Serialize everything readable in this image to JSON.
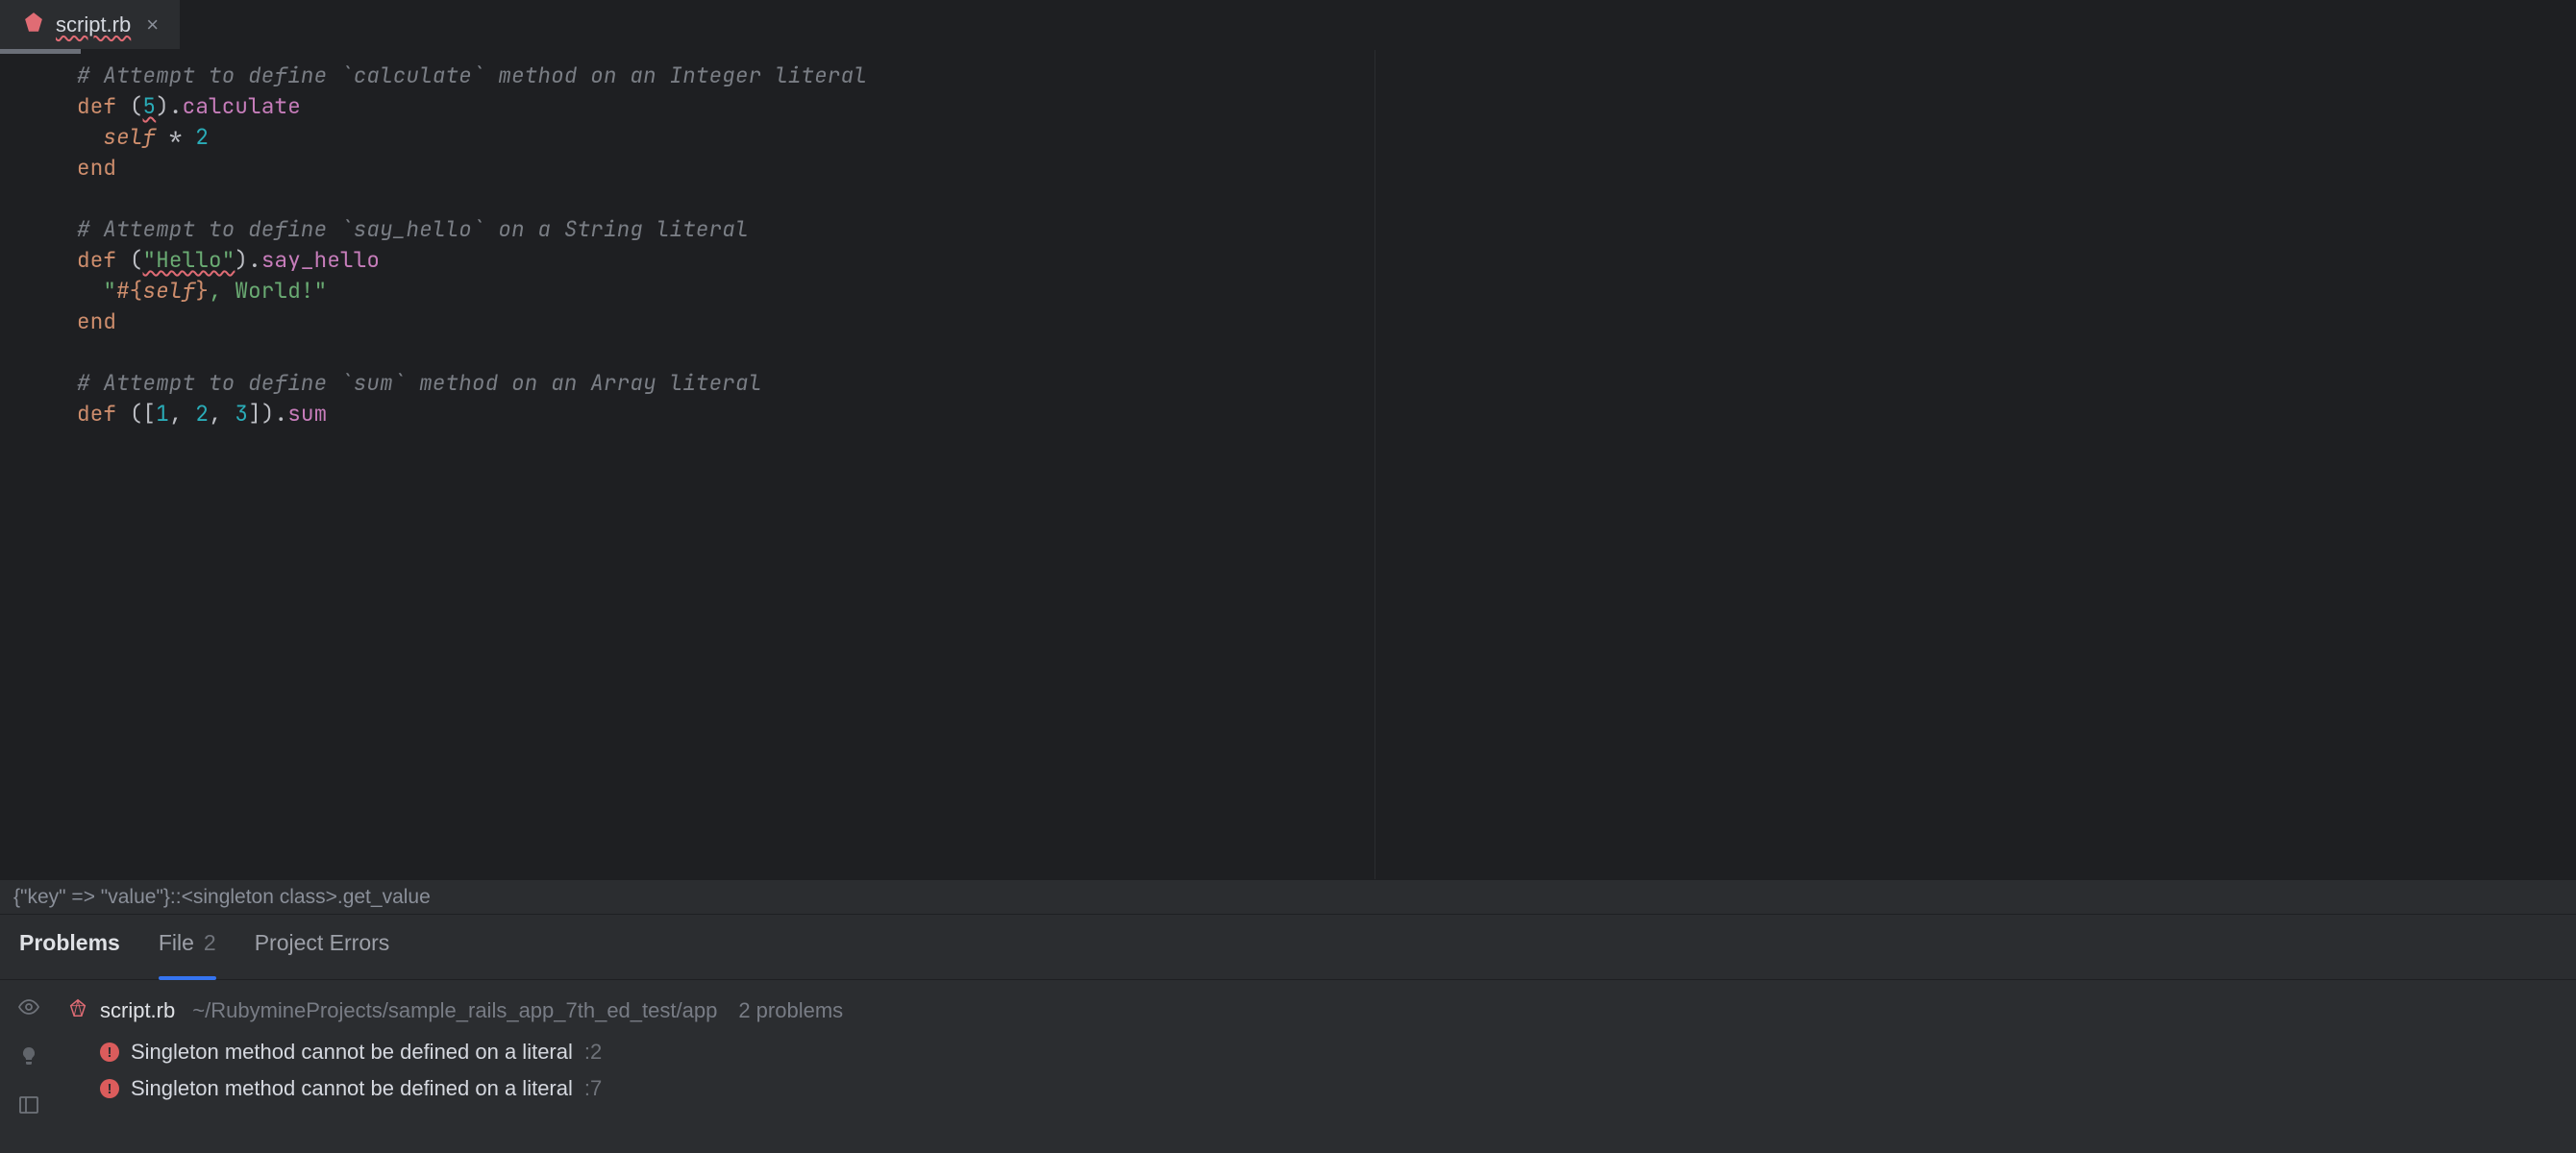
{
  "tab": {
    "filename": "script.rb",
    "close_glyph": "×"
  },
  "code": {
    "l1_comment": "# Attempt to define `calculate` method on an Integer literal",
    "l2_def": "def",
    "l2_open": " (",
    "l2_lit": "5",
    "l2_close": ").",
    "l2_method": "calculate",
    "l3_indent": "  ",
    "l3_self": "self",
    "l3_op": " * ",
    "l3_num": "2",
    "l4_end": "end",
    "l6_comment": "# Attempt to define `say_hello` on a String literal",
    "l7_def": "def",
    "l7_open": " (",
    "l7_lit": "\"Hello\"",
    "l7_close": ").",
    "l7_method": "say_hello",
    "l8_indent": "  ",
    "l8_q1": "\"",
    "l8_io": "#{",
    "l8_self": "self",
    "l8_ic": "}",
    "l8_tail": ", World!\"",
    "l9_end": "end",
    "l11_comment": "# Attempt to define `sum` method on an Array literal",
    "l12_def": "def",
    "l12_open": " ([",
    "l12_a": "1",
    "l12_s1": ", ",
    "l12_b": "2",
    "l12_s2": ", ",
    "l12_c": "3",
    "l12_close": "]).",
    "l12_method": "sum"
  },
  "breadcrumb": {
    "text": "{\"key\" => \"value\"}::<singleton class>.get_value"
  },
  "panel": {
    "tabs": {
      "problems": "Problems",
      "file": "File",
      "file_count": "2",
      "project_errors": "Project Errors"
    },
    "file": {
      "name": "script.rb",
      "path": "~/RubymineProjects/sample_rails_app_7th_ed_test/app",
      "count": "2 problems"
    },
    "problems": [
      {
        "text": "Singleton method cannot be defined on a literal",
        "line": ":2"
      },
      {
        "text": "Singleton method cannot be defined on a literal",
        "line": ":7"
      }
    ]
  }
}
